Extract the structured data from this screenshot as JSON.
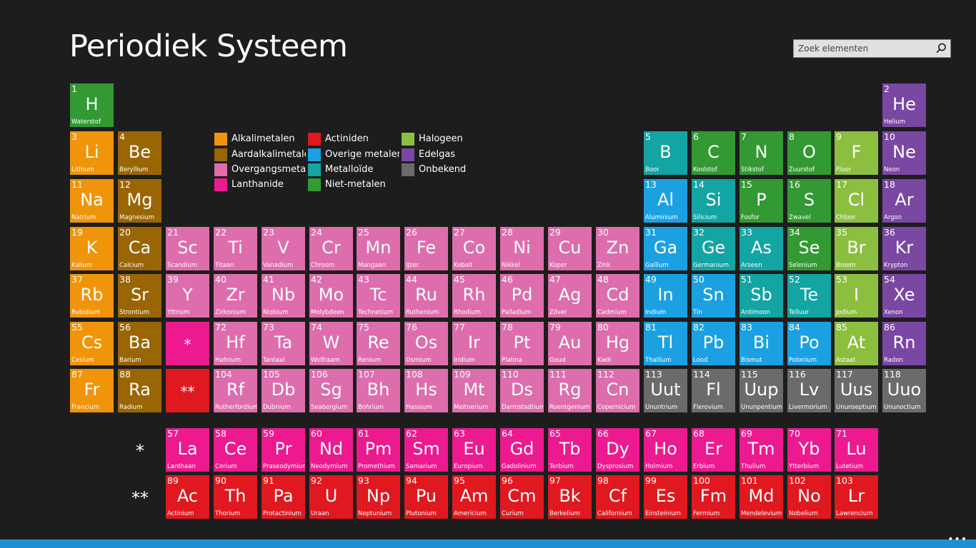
{
  "header": {
    "title": "Periodiek Systeem"
  },
  "search": {
    "placeholder": "Zoek elementen",
    "icon": "search-icon"
  },
  "colors": {
    "alkali": "#f0940a",
    "alkaline": "#9a6503",
    "transition": "#de6dad",
    "lanthanide": "#ec1a8e",
    "actinide": "#e0181f",
    "other_metal": "#1ba1e2",
    "metalloid": "#13a4a4",
    "nonmetal": "#339933",
    "halogen": "#8cbf3f",
    "noble": "#7a47a3",
    "unknown": "#6b6b6b"
  },
  "legend": [
    {
      "label": "Alkalimetalen",
      "cat": "alkali"
    },
    {
      "label": "Aardalkalimetalen",
      "cat": "alkaline"
    },
    {
      "label": "Overgangsmetalen",
      "cat": "transition"
    },
    {
      "label": "Lanthanide",
      "cat": "lanthanide"
    },
    {
      "label": "Actiniden",
      "cat": "actinide"
    },
    {
      "label": "Overige metalen",
      "cat": "other_metal"
    },
    {
      "label": "Metalloïde",
      "cat": "metalloid"
    },
    {
      "label": "Niet-metalen",
      "cat": "nonmetal"
    },
    {
      "label": "Halogeen",
      "cat": "halogen"
    },
    {
      "label": "Edelgas",
      "cat": "noble"
    },
    {
      "label": "Onbekend",
      "cat": "unknown"
    }
  ],
  "placeholders": [
    {
      "symbol": "*",
      "cat": "lanthanide",
      "col": 3,
      "row": 6
    },
    {
      "symbol": "**",
      "cat": "actinide",
      "col": 3,
      "row": 7
    }
  ],
  "series_markers": [
    {
      "symbol": "*",
      "row": 9
    },
    {
      "symbol": "**",
      "row": 10
    }
  ],
  "elements": [
    {
      "n": 1,
      "s": "H",
      "name": "Waterstof",
      "cat": "nonmetal",
      "col": 1,
      "row": 1
    },
    {
      "n": 2,
      "s": "He",
      "name": "Helium",
      "cat": "noble",
      "col": 18,
      "row": 1
    },
    {
      "n": 3,
      "s": "Li",
      "name": "Lithium",
      "cat": "alkali",
      "col": 1,
      "row": 2
    },
    {
      "n": 4,
      "s": "Be",
      "name": "Beryllium",
      "cat": "alkaline",
      "col": 2,
      "row": 2
    },
    {
      "n": 5,
      "s": "B",
      "name": "Boor",
      "cat": "metalloid",
      "col": 13,
      "row": 2
    },
    {
      "n": 6,
      "s": "C",
      "name": "Koolstof",
      "cat": "nonmetal",
      "col": 14,
      "row": 2
    },
    {
      "n": 7,
      "s": "N",
      "name": "Stikstof",
      "cat": "nonmetal",
      "col": 15,
      "row": 2
    },
    {
      "n": 8,
      "s": "O",
      "name": "Zuurstof",
      "cat": "nonmetal",
      "col": 16,
      "row": 2
    },
    {
      "n": 9,
      "s": "F",
      "name": "Fluor",
      "cat": "halogen",
      "col": 17,
      "row": 2
    },
    {
      "n": 10,
      "s": "Ne",
      "name": "Neon",
      "cat": "noble",
      "col": 18,
      "row": 2
    },
    {
      "n": 11,
      "s": "Na",
      "name": "Natrium",
      "cat": "alkali",
      "col": 1,
      "row": 3
    },
    {
      "n": 12,
      "s": "Mg",
      "name": "Magnesium",
      "cat": "alkaline",
      "col": 2,
      "row": 3
    },
    {
      "n": 13,
      "s": "Al",
      "name": "Aluminium",
      "cat": "other_metal",
      "col": 13,
      "row": 3
    },
    {
      "n": 14,
      "s": "Si",
      "name": "Silicium",
      "cat": "metalloid",
      "col": 14,
      "row": 3
    },
    {
      "n": 15,
      "s": "P",
      "name": "Fosfor",
      "cat": "nonmetal",
      "col": 15,
      "row": 3
    },
    {
      "n": 16,
      "s": "S",
      "name": "Zwavel",
      "cat": "nonmetal",
      "col": 16,
      "row": 3
    },
    {
      "n": 17,
      "s": "Cl",
      "name": "Chloor",
      "cat": "halogen",
      "col": 17,
      "row": 3
    },
    {
      "n": 18,
      "s": "Ar",
      "name": "Argon",
      "cat": "noble",
      "col": 18,
      "row": 3
    },
    {
      "n": 19,
      "s": "K",
      "name": "Kalium",
      "cat": "alkali",
      "col": 1,
      "row": 4
    },
    {
      "n": 20,
      "s": "Ca",
      "name": "Calcium",
      "cat": "alkaline",
      "col": 2,
      "row": 4
    },
    {
      "n": 21,
      "s": "Sc",
      "name": "Scandium",
      "cat": "transition",
      "col": 3,
      "row": 4
    },
    {
      "n": 22,
      "s": "Ti",
      "name": "Titaan",
      "cat": "transition",
      "col": 4,
      "row": 4
    },
    {
      "n": 23,
      "s": "V",
      "name": "Vanadium",
      "cat": "transition",
      "col": 5,
      "row": 4
    },
    {
      "n": 24,
      "s": "Cr",
      "name": "Chroom",
      "cat": "transition",
      "col": 6,
      "row": 4
    },
    {
      "n": 25,
      "s": "Mn",
      "name": "Mangaan",
      "cat": "transition",
      "col": 7,
      "row": 4
    },
    {
      "n": 26,
      "s": "Fe",
      "name": "IJzer",
      "cat": "transition",
      "col": 8,
      "row": 4
    },
    {
      "n": 27,
      "s": "Co",
      "name": "Kobalt",
      "cat": "transition",
      "col": 9,
      "row": 4
    },
    {
      "n": 28,
      "s": "Ni",
      "name": "Nikkel",
      "cat": "transition",
      "col": 10,
      "row": 4
    },
    {
      "n": 29,
      "s": "Cu",
      "name": "Koper",
      "cat": "transition",
      "col": 11,
      "row": 4
    },
    {
      "n": 30,
      "s": "Zn",
      "name": "Zink",
      "cat": "transition",
      "col": 12,
      "row": 4
    },
    {
      "n": 31,
      "s": "Ga",
      "name": "Gallium",
      "cat": "other_metal",
      "col": 13,
      "row": 4
    },
    {
      "n": 32,
      "s": "Ge",
      "name": "Germanium",
      "cat": "metalloid",
      "col": 14,
      "row": 4
    },
    {
      "n": 33,
      "s": "As",
      "name": "Arseen",
      "cat": "metalloid",
      "col": 15,
      "row": 4
    },
    {
      "n": 34,
      "s": "Se",
      "name": "Selenium",
      "cat": "nonmetal",
      "col": 16,
      "row": 4
    },
    {
      "n": 35,
      "s": "Br",
      "name": "Broom",
      "cat": "halogen",
      "col": 17,
      "row": 4
    },
    {
      "n": 36,
      "s": "Kr",
      "name": "Krypton",
      "cat": "noble",
      "col": 18,
      "row": 4
    },
    {
      "n": 37,
      "s": "Rb",
      "name": "Rubidium",
      "cat": "alkali",
      "col": 1,
      "row": 5
    },
    {
      "n": 38,
      "s": "Sr",
      "name": "Strontium",
      "cat": "alkaline",
      "col": 2,
      "row": 5
    },
    {
      "n": 39,
      "s": "Y",
      "name": "Yttrium",
      "cat": "transition",
      "col": 3,
      "row": 5
    },
    {
      "n": 40,
      "s": "Zr",
      "name": "Zirkonium",
      "cat": "transition",
      "col": 4,
      "row": 5
    },
    {
      "n": 41,
      "s": "Nb",
      "name": "Niobium",
      "cat": "transition",
      "col": 5,
      "row": 5
    },
    {
      "n": 42,
      "s": "Mo",
      "name": "Molybdeen",
      "cat": "transition",
      "col": 6,
      "row": 5
    },
    {
      "n": 43,
      "s": "Tc",
      "name": "Technetium",
      "cat": "transition",
      "col": 7,
      "row": 5
    },
    {
      "n": 44,
      "s": "Ru",
      "name": "Ruthenium",
      "cat": "transition",
      "col": 8,
      "row": 5
    },
    {
      "n": 45,
      "s": "Rh",
      "name": "Rhodium",
      "cat": "transition",
      "col": 9,
      "row": 5
    },
    {
      "n": 46,
      "s": "Pd",
      "name": "Palladium",
      "cat": "transition",
      "col": 10,
      "row": 5
    },
    {
      "n": 47,
      "s": "Ag",
      "name": "Zilver",
      "cat": "transition",
      "col": 11,
      "row": 5
    },
    {
      "n": 48,
      "s": "Cd",
      "name": "Cadmium",
      "cat": "transition",
      "col": 12,
      "row": 5
    },
    {
      "n": 49,
      "s": "In",
      "name": "Indium",
      "cat": "other_metal",
      "col": 13,
      "row": 5
    },
    {
      "n": 50,
      "s": "Sn",
      "name": "Tin",
      "cat": "other_metal",
      "col": 14,
      "row": 5
    },
    {
      "n": 51,
      "s": "Sb",
      "name": "Antimoon",
      "cat": "metalloid",
      "col": 15,
      "row": 5
    },
    {
      "n": 52,
      "s": "Te",
      "name": "Telluur",
      "cat": "metalloid",
      "col": 16,
      "row": 5
    },
    {
      "n": 53,
      "s": "I",
      "name": "Jodium",
      "cat": "halogen",
      "col": 17,
      "row": 5
    },
    {
      "n": 54,
      "s": "Xe",
      "name": "Xenon",
      "cat": "noble",
      "col": 18,
      "row": 5
    },
    {
      "n": 55,
      "s": "Cs",
      "name": "Cesium",
      "cat": "alkali",
      "col": 1,
      "row": 6
    },
    {
      "n": 56,
      "s": "Ba",
      "name": "Barium",
      "cat": "alkaline",
      "col": 2,
      "row": 6
    },
    {
      "n": 72,
      "s": "Hf",
      "name": "Hafnium",
      "cat": "transition",
      "col": 4,
      "row": 6
    },
    {
      "n": 73,
      "s": "Ta",
      "name": "Tantaal",
      "cat": "transition",
      "col": 5,
      "row": 6
    },
    {
      "n": 74,
      "s": "W",
      "name": "Wolfraam",
      "cat": "transition",
      "col": 6,
      "row": 6
    },
    {
      "n": 75,
      "s": "Re",
      "name": "Renium",
      "cat": "transition",
      "col": 7,
      "row": 6
    },
    {
      "n": 76,
      "s": "Os",
      "name": "Osmium",
      "cat": "transition",
      "col": 8,
      "row": 6
    },
    {
      "n": 77,
      "s": "Ir",
      "name": "Iridium",
      "cat": "transition",
      "col": 9,
      "row": 6
    },
    {
      "n": 78,
      "s": "Pt",
      "name": "Platina",
      "cat": "transition",
      "col": 10,
      "row": 6
    },
    {
      "n": 79,
      "s": "Au",
      "name": "Goud",
      "cat": "transition",
      "col": 11,
      "row": 6
    },
    {
      "n": 80,
      "s": "Hg",
      "name": "Kwik",
      "cat": "transition",
      "col": 12,
      "row": 6
    },
    {
      "n": 81,
      "s": "Tl",
      "name": "Thallium",
      "cat": "other_metal",
      "col": 13,
      "row": 6
    },
    {
      "n": 82,
      "s": "Pb",
      "name": "Lood",
      "cat": "other_metal",
      "col": 14,
      "row": 6
    },
    {
      "n": 83,
      "s": "Bi",
      "name": "Bismut",
      "cat": "other_metal",
      "col": 15,
      "row": 6
    },
    {
      "n": 84,
      "s": "Po",
      "name": "Polonium",
      "cat": "other_metal",
      "col": 16,
      "row": 6
    },
    {
      "n": 85,
      "s": "At",
      "name": "Astaat",
      "cat": "halogen",
      "col": 17,
      "row": 6
    },
    {
      "n": 86,
      "s": "Rn",
      "name": "Radon",
      "cat": "noble",
      "col": 18,
      "row": 6
    },
    {
      "n": 87,
      "s": "Fr",
      "name": "Francium",
      "cat": "alkali",
      "col": 1,
      "row": 7
    },
    {
      "n": 88,
      "s": "Ra",
      "name": "Radium",
      "cat": "alkaline",
      "col": 2,
      "row": 7
    },
    {
      "n": 104,
      "s": "Rf",
      "name": "Rutherfordium",
      "cat": "transition",
      "col": 4,
      "row": 7
    },
    {
      "n": 105,
      "s": "Db",
      "name": "Dubnium",
      "cat": "transition",
      "col": 5,
      "row": 7
    },
    {
      "n": 106,
      "s": "Sg",
      "name": "Seaborgium",
      "cat": "transition",
      "col": 6,
      "row": 7
    },
    {
      "n": 107,
      "s": "Bh",
      "name": "Bohrium",
      "cat": "transition",
      "col": 7,
      "row": 7
    },
    {
      "n": 108,
      "s": "Hs",
      "name": "Hassium",
      "cat": "transition",
      "col": 8,
      "row": 7
    },
    {
      "n": 109,
      "s": "Mt",
      "name": "Meitnerium",
      "cat": "transition",
      "col": 9,
      "row": 7
    },
    {
      "n": 110,
      "s": "Ds",
      "name": "Darmstadtium",
      "cat": "transition",
      "col": 10,
      "row": 7
    },
    {
      "n": 111,
      "s": "Rg",
      "name": "Roentgenium",
      "cat": "transition",
      "col": 11,
      "row": 7
    },
    {
      "n": 112,
      "s": "Cn",
      "name": "Copernicium",
      "cat": "transition",
      "col": 12,
      "row": 7
    },
    {
      "n": 113,
      "s": "Uut",
      "name": "Ununtrium",
      "cat": "unknown",
      "col": 13,
      "row": 7
    },
    {
      "n": 114,
      "s": "Fl",
      "name": "Flerovium",
      "cat": "unknown",
      "col": 14,
      "row": 7
    },
    {
      "n": 115,
      "s": "Uup",
      "name": "Ununpentium",
      "cat": "unknown",
      "col": 15,
      "row": 7
    },
    {
      "n": 116,
      "s": "Lv",
      "name": "Livermorium",
      "cat": "unknown",
      "col": 16,
      "row": 7
    },
    {
      "n": 117,
      "s": "Uus",
      "name": "Ununseptium",
      "cat": "unknown",
      "col": 17,
      "row": 7
    },
    {
      "n": 118,
      "s": "Uuo",
      "name": "Ununoctium",
      "cat": "unknown",
      "col": 18,
      "row": 7
    },
    {
      "n": 57,
      "s": "La",
      "name": "Lanthaan",
      "cat": "lanthanide",
      "col": 3,
      "row": 9
    },
    {
      "n": 58,
      "s": "Ce",
      "name": "Cerium",
      "cat": "lanthanide",
      "col": 4,
      "row": 9
    },
    {
      "n": 59,
      "s": "Pr",
      "name": "Praseodymium",
      "cat": "lanthanide",
      "col": 5,
      "row": 9
    },
    {
      "n": 60,
      "s": "Nd",
      "name": "Neodymium",
      "cat": "lanthanide",
      "col": 6,
      "row": 9
    },
    {
      "n": 61,
      "s": "Pm",
      "name": "Promethium",
      "cat": "lanthanide",
      "col": 7,
      "row": 9
    },
    {
      "n": 62,
      "s": "Sm",
      "name": "Samarium",
      "cat": "lanthanide",
      "col": 8,
      "row": 9
    },
    {
      "n": 63,
      "s": "Eu",
      "name": "Europium",
      "cat": "lanthanide",
      "col": 9,
      "row": 9
    },
    {
      "n": 64,
      "s": "Gd",
      "name": "Gadolinium",
      "cat": "lanthanide",
      "col": 10,
      "row": 9
    },
    {
      "n": 65,
      "s": "Tb",
      "name": "Terbium",
      "cat": "lanthanide",
      "col": 11,
      "row": 9
    },
    {
      "n": 66,
      "s": "Dy",
      "name": "Dysprosium",
      "cat": "lanthanide",
      "col": 12,
      "row": 9
    },
    {
      "n": 67,
      "s": "Ho",
      "name": "Holmium",
      "cat": "lanthanide",
      "col": 13,
      "row": 9
    },
    {
      "n": 68,
      "s": "Er",
      "name": "Erbium",
      "cat": "lanthanide",
      "col": 14,
      "row": 9
    },
    {
      "n": 69,
      "s": "Tm",
      "name": "Thulium",
      "cat": "lanthanide",
      "col": 15,
      "row": 9
    },
    {
      "n": 70,
      "s": "Yb",
      "name": "Ytterbium",
      "cat": "lanthanide",
      "col": 16,
      "row": 9
    },
    {
      "n": 71,
      "s": "Lu",
      "name": "Lutetium",
      "cat": "lanthanide",
      "col": 17,
      "row": 9
    },
    {
      "n": 89,
      "s": "Ac",
      "name": "Actinium",
      "cat": "actinide",
      "col": 3,
      "row": 10
    },
    {
      "n": 90,
      "s": "Th",
      "name": "Thorium",
      "cat": "actinide",
      "col": 4,
      "row": 10
    },
    {
      "n": 91,
      "s": "Pa",
      "name": "Protactinium",
      "cat": "actinide",
      "col": 5,
      "row": 10
    },
    {
      "n": 92,
      "s": "U",
      "name": "Uraan",
      "cat": "actinide",
      "col": 6,
      "row": 10
    },
    {
      "n": 93,
      "s": "Np",
      "name": "Neptunium",
      "cat": "actinide",
      "col": 7,
      "row": 10
    },
    {
      "n": 94,
      "s": "Pu",
      "name": "Plutonium",
      "cat": "actinide",
      "col": 8,
      "row": 10
    },
    {
      "n": 95,
      "s": "Am",
      "name": "Americium",
      "cat": "actinide",
      "col": 9,
      "row": 10
    },
    {
      "n": 96,
      "s": "Cm",
      "name": "Curium",
      "cat": "actinide",
      "col": 10,
      "row": 10
    },
    {
      "n": 97,
      "s": "Bk",
      "name": "Berkelium",
      "cat": "actinide",
      "col": 11,
      "row": 10
    },
    {
      "n": 98,
      "s": "Cf",
      "name": "Californium",
      "cat": "actinide",
      "col": 12,
      "row": 10
    },
    {
      "n": 99,
      "s": "Es",
      "name": "Einsteinium",
      "cat": "actinide",
      "col": 13,
      "row": 10
    },
    {
      "n": 100,
      "s": "Fm",
      "name": "Fermium",
      "cat": "actinide",
      "col": 14,
      "row": 10
    },
    {
      "n": 101,
      "s": "Md",
      "name": "Mendelevium",
      "cat": "actinide",
      "col": 15,
      "row": 10
    },
    {
      "n": 102,
      "s": "No",
      "name": "Nobelium",
      "cat": "actinide",
      "col": 16,
      "row": 10
    },
    {
      "n": 103,
      "s": "Lr",
      "name": "Lawrencium",
      "cat": "actinide",
      "col": 17,
      "row": 10
    }
  ],
  "appbar": {
    "more_label": "•••"
  }
}
